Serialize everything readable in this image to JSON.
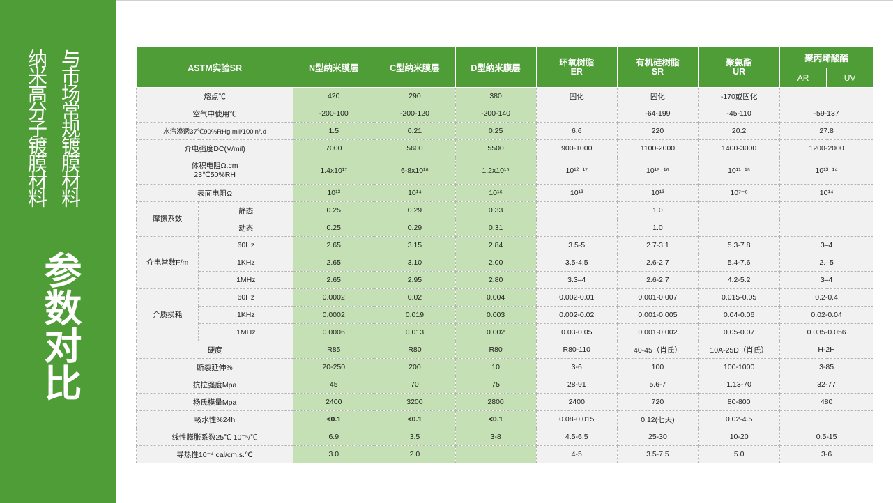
{
  "sidebar": {
    "col1": "纳米高分子镀膜材料",
    "col2": "与市场常规镀膜材料",
    "title": "参数对比"
  },
  "theme": {
    "accent": "#4e9d36",
    "highlight": "#c5e0b4",
    "cell": "#f1f1f1"
  },
  "table": {
    "headers": {
      "c0": "ASTM实验SR",
      "c1": "N型纳米膜层",
      "c2": "C型纳米膜层",
      "c3": "D型纳米膜层",
      "c4a": "环氧树脂",
      "c4b": "ER",
      "c5a": "有机硅树脂",
      "c5b": "SR",
      "c6a": "聚氨酯",
      "c6b": "UR",
      "c7": "聚丙烯酸酯",
      "c7_ar": "AR",
      "c7_uv": "UV"
    },
    "groups": {
      "friction": "摩擦系数",
      "dielectric": "介电常数F/m",
      "loss": "介质损耗"
    },
    "rows": {
      "r1": [
        "熔点℃",
        "420",
        "290",
        "380",
        "固化",
        "固化",
        "-170或固化",
        ""
      ],
      "r2": [
        "空气中使用℃",
        "-200-100",
        "-200-120",
        "-200-140",
        "",
        "-64-199",
        "-45-110",
        "-59-137"
      ],
      "r3": [
        "水汽渗透37℃90%RHg.mil/100in².d",
        "1.5",
        "0.21",
        "0.25",
        "6.6",
        "220",
        "20.2",
        "27.8"
      ],
      "r4": [
        "介电强度DC(V/mil)",
        "7000",
        "5600",
        "5500",
        "900-1000",
        "1100-2000",
        "1400-3000",
        "1200-2000"
      ],
      "r5a": "体积电阻Ω.cm",
      "r5b": "23℃50%RH",
      "r5": [
        "",
        "1.4x10¹⁷",
        "6-8x10¹⁶",
        "1.2x10¹⁶",
        "10¹²⁻¹⁷",
        "10¹⁵⁻¹⁶",
        "10¹¹⁻¹⁵",
        "10¹³⁻¹⁴"
      ],
      "r6": [
        "表面电阻Ω",
        "10¹³",
        "10¹⁴",
        "10¹⁶",
        "10¹³",
        "10¹³",
        "10⁷⁻⁸",
        "10¹⁴"
      ],
      "f1": [
        "静态",
        "0.25",
        "0.29",
        "0.33",
        "",
        "1.0",
        "",
        ""
      ],
      "f2": [
        "动态",
        "0.25",
        "0.29",
        "0.31",
        "",
        "1.0",
        "",
        ""
      ],
      "d1": [
        "60Hz",
        "2.65",
        "3.15",
        "2.84",
        "3.5-5",
        "2.7-3.1",
        "5.3-7.8",
        "3–4"
      ],
      "d2": [
        "1KHz",
        "2.65",
        "3.10",
        "2.00",
        "3.5-4.5",
        "2.6-2.7",
        "5.4-7.6",
        "2.–5"
      ],
      "d3": [
        "1MHz",
        "2.65",
        "2.95",
        "2.80",
        "3.3–4",
        "2.6-2.7",
        "4.2-5.2",
        "3–4"
      ],
      "l1": [
        "60Hz",
        "0.0002",
        "0.02",
        "0.004",
        "0.002-0.01",
        "0.001-0.007",
        "0.015-0.05",
        "0.2-0.4"
      ],
      "l2": [
        "1KHz",
        "0.0002",
        "0.019",
        "0.003",
        "0.002-0.02",
        "0.001-0.005",
        "0.04-0.06",
        "0.02-0.04"
      ],
      "l3": [
        "1MHz",
        "0.0006",
        "0.013",
        "0.002",
        "0.03-0.05",
        "0.001-0.002",
        "0.05-0.07",
        "0.035-0.056"
      ],
      "r7": [
        "硬度",
        "R85",
        "R80",
        "R80",
        "R80-110",
        "40-45（肖氏）",
        "10A-25D（肖氏）",
        "H-2H"
      ],
      "r8": [
        "断裂延伸%",
        "20-250",
        "200",
        "10",
        "3-6",
        "100",
        "100-1000",
        "3-85"
      ],
      "r9": [
        "抗拉强度Mpa",
        "45",
        "70",
        "75",
        "28-91",
        "5.6-7",
        "1.13-70",
        "32-77"
      ],
      "r10": [
        "杨氏模量Mpa",
        "2400",
        "3200",
        "2800",
        "2400",
        "720",
        "80-800",
        "480"
      ],
      "r11": [
        "吸水性%24h",
        "<0.1",
        "<0.1",
        "<0.1",
        "0.08-0.015",
        "0.12(七天)",
        "0.02-4.5",
        ""
      ],
      "r12": [
        "线性膨胀系数25℃ 10⁻⁵/℃",
        "6.9",
        "3.5",
        "3-8",
        "4.5-6.5",
        "25-30",
        "10-20",
        "0.5-15"
      ],
      "r13": [
        "导热性10⁻⁴ cal/cm.s.℃",
        "3.0",
        "2.0",
        "",
        "4-5",
        "3.5-7.5",
        "5.0",
        "3-6"
      ]
    }
  }
}
